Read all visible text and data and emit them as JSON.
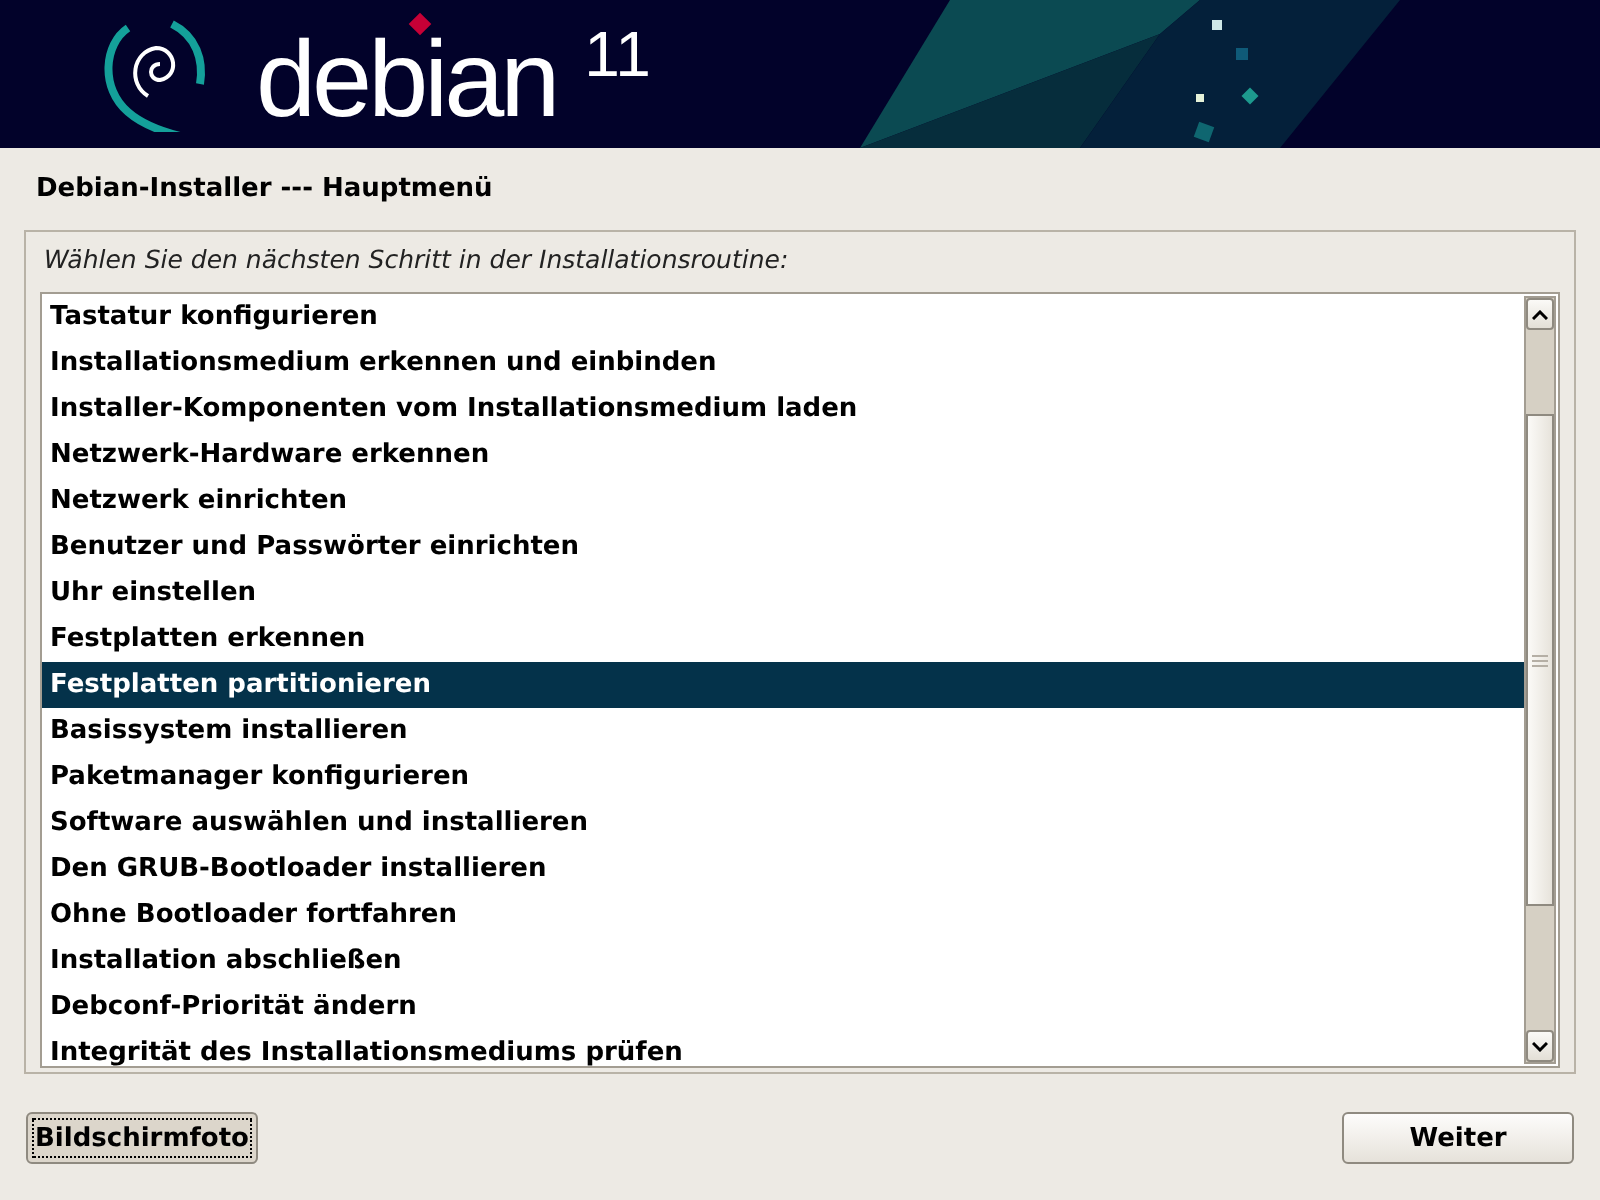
{
  "banner": {
    "logo": "debian",
    "version": "11"
  },
  "title": "Debian-Installer --- Hauptmenü",
  "prompt": "Wählen Sie den nächsten Schritt in der Installationsroutine:",
  "items": [
    {
      "label": "Tastatur konfigurieren",
      "selected": false
    },
    {
      "label": "Installationsmedium erkennen und einbinden",
      "selected": false
    },
    {
      "label": "Installer-Komponenten vom Installationsmedium laden",
      "selected": false
    },
    {
      "label": "Netzwerk-Hardware erkennen",
      "selected": false
    },
    {
      "label": "Netzwerk einrichten",
      "selected": false
    },
    {
      "label": "Benutzer und Passwörter einrichten",
      "selected": false
    },
    {
      "label": "Uhr einstellen",
      "selected": false
    },
    {
      "label": "Festplatten erkennen",
      "selected": false
    },
    {
      "label": "Festplatten partitionieren",
      "selected": true
    },
    {
      "label": "Basissystem installieren",
      "selected": false
    },
    {
      "label": "Paketmanager konfigurieren",
      "selected": false
    },
    {
      "label": "Software auswählen und installieren",
      "selected": false
    },
    {
      "label": "Den GRUB-Bootloader installieren",
      "selected": false
    },
    {
      "label": "Ohne Bootloader fortfahren",
      "selected": false
    },
    {
      "label": "Installation abschließen",
      "selected": false
    },
    {
      "label": "Debconf-Priorität ändern",
      "selected": false
    },
    {
      "label": "Integrität des Installationsmediums prüfen",
      "selected": false
    }
  ],
  "buttons": [
    {
      "label": "Bildschirmfoto",
      "focused": true
    },
    {
      "label": "Weiter",
      "focused": false
    }
  ]
}
